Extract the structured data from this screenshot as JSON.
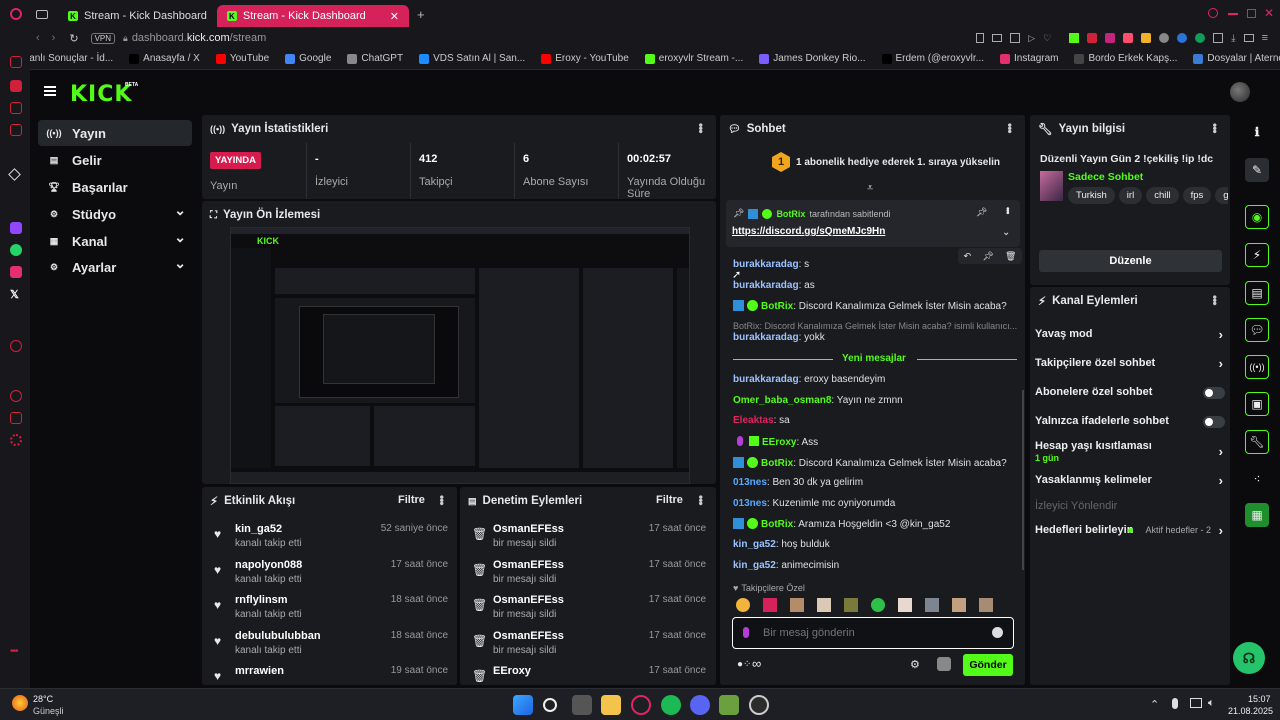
{
  "browser": {
    "tabs": [
      {
        "label": "Stream - Kick Dashboard",
        "active": false
      },
      {
        "label": "Stream - Kick Dashboard",
        "active": true
      }
    ],
    "vpn": "VPN",
    "url_host": "dashboard.",
    "url_domain": "kick.com",
    "url_path": "/stream",
    "bookmarks": [
      {
        "label": "Canlı Sonuçlar - İd...",
        "color": "#1e6fd9"
      },
      {
        "label": "Anasayfa / X",
        "color": "#000000"
      },
      {
        "label": "YouTube",
        "color": "#ff0000"
      },
      {
        "label": "Google",
        "color": "#4285f4"
      },
      {
        "label": "ChatGPT",
        "color": "#888888"
      },
      {
        "label": "VDS Satın Al | San...",
        "color": "#1a8cff"
      },
      {
        "label": "Eroxy - YouTube",
        "color": "#ff0000"
      },
      {
        "label": "eroxyvlr Stream -...",
        "color": "#53fc18"
      },
      {
        "label": "James Donkey Rio...",
        "color": "#7a5cff"
      },
      {
        "label": "Erdem (@eroxyvlr...",
        "color": "#000000"
      },
      {
        "label": "Instagram",
        "color": "#e1306c"
      },
      {
        "label": "Bordo Erkek Kapş...",
        "color": "#444444"
      },
      {
        "label": "Dosyalar | Aternos...",
        "color": "#3a7bd5"
      }
    ]
  },
  "kick": {
    "logo": "KICK",
    "beta": "BETA"
  },
  "sidebar": {
    "items": [
      {
        "label": "Yayın",
        "icon": "broadcast-icon",
        "active": true,
        "chev": false
      },
      {
        "label": "Gelir",
        "icon": "revenue-icon",
        "active": false,
        "chev": false
      },
      {
        "label": "Başarılar",
        "icon": "trophy-icon",
        "active": false,
        "chev": false
      },
      {
        "label": "Stüdyo",
        "icon": "studio-icon",
        "active": false,
        "chev": true
      },
      {
        "label": "Kanal",
        "icon": "channel-icon",
        "active": false,
        "chev": true
      },
      {
        "label": "Ayarlar",
        "icon": "settings-icon",
        "active": false,
        "chev": true
      }
    ]
  },
  "stats": {
    "title": "Yayın İstatistikleri",
    "live_badge": "YAYINDA",
    "items": [
      {
        "value": "",
        "label": "Yayın"
      },
      {
        "value": "-",
        "label": "İzleyici"
      },
      {
        "value": "412",
        "label": "Takipçi"
      },
      {
        "value": "6",
        "label": "Abone Sayısı"
      },
      {
        "value": "00:02:57",
        "label": "Yayında Olduğu Süre"
      }
    ]
  },
  "preview": {
    "title": "Yayın Ön İzlemesi"
  },
  "activity": {
    "title": "Etkinlik Akışı",
    "filter": "Filtre",
    "items": [
      {
        "name": "kin_ga52",
        "sub": "kanalı takip etti",
        "time": "52 saniye önce"
      },
      {
        "name": "napolyon088",
        "sub": "kanalı takip etti",
        "time": "17 saat önce"
      },
      {
        "name": "rnflylinsm",
        "sub": "kanalı takip etti",
        "time": "18 saat önce"
      },
      {
        "name": "debulubulubban",
        "sub": "kanalı takip etti",
        "time": "18 saat önce"
      },
      {
        "name": "mrrawien",
        "sub": "",
        "time": "19 saat önce"
      }
    ]
  },
  "moderation": {
    "title": "Denetim Eylemleri",
    "filter": "Filtre",
    "items": [
      {
        "name": "OsmanEFEss",
        "sub": "bir mesajı sildi",
        "time": "17 saat önce"
      },
      {
        "name": "OsmanEFEss",
        "sub": "bir mesajı sildi",
        "time": "17 saat önce"
      },
      {
        "name": "OsmanEFEss",
        "sub": "bir mesajı sildi",
        "time": "17 saat önce"
      },
      {
        "name": "OsmanEFEss",
        "sub": "bir mesajı sildi",
        "time": "17 saat önce"
      },
      {
        "name": "EEroxy",
        "sub": "",
        "time": "17 saat önce"
      }
    ]
  },
  "chat": {
    "title": "Sohbet",
    "gift_banner_number": "1",
    "gift_banner": "1 abonelik hediye ederek 1. sıraya yükselin",
    "pinned_by_user": "BotRix",
    "pinned_by_text": "tarafından sabitlendi",
    "pinned_link": "https://discord.gg/sQmeMJc9Hn",
    "messages": [
      {
        "user": "burakkaradag",
        "color": "#9cc3ff",
        "text": ": s"
      },
      {
        "user": "burakkaradag",
        "color": "#9cc3ff",
        "text": ": as"
      },
      {
        "user": "BotRix",
        "color": "#53fc18",
        "text": ": Discord Kanalımıza Gelmek İster Misin acaba?",
        "bot": true
      },
      {
        "reply": "BotRix: Discord Kanalımıza Gelmek İster Misin acaba? isimli kullanıcı..."
      },
      {
        "user": "burakkaradag",
        "color": "#9cc3ff",
        "text": ": yokk"
      }
    ],
    "new_messages": "Yeni mesajlar",
    "messages2": [
      {
        "user": "burakkaradag",
        "color": "#9cc3ff",
        "text": ": eroxy basendeyim"
      },
      {
        "user": "Omer_baba_osman8",
        "color": "#53fc18",
        "text": ": Yayın ne zmnn"
      },
      {
        "user": "Eleaktas",
        "color": "#e0245e",
        "text": ": sa"
      },
      {
        "user": "EEroxy",
        "color": "#53fc18",
        "text": ": Ass",
        "badges": true
      },
      {
        "user": "BotRix",
        "color": "#53fc18",
        "text": ": Discord Kanalımıza Gelmek İster Misin acaba?",
        "bot": true
      },
      {
        "user": "013nes",
        "color": "#5aa9ff",
        "text": ": Ben 30 dk ya gelirim"
      },
      {
        "user": "013nes",
        "color": "#5aa9ff",
        "text": ": Kuzenimle mc oyniyorumda"
      },
      {
        "user": "BotRix",
        "color": "#53fc18",
        "text": ": Aramıza Hoşgeldin <3 @kin_ga52",
        "bot": true
      },
      {
        "user": "kin_ga52",
        "color": "#9cc3ff",
        "text": ": hoş bulduk"
      },
      {
        "user": "kin_ga52",
        "color": "#9cc3ff",
        "text": ": animecimisin"
      }
    ],
    "followers_only_label": "Takipçilere Özel",
    "input_placeholder": "Bir mesaj gönderin",
    "send_label": "Gönder"
  },
  "streaminfo": {
    "title": "Yayın bilgisi",
    "stream_title": "Düzenli Yayın Gün 2 !çekiliş !ip !dc",
    "category": "Sadece Sohbet",
    "tags": [
      "Turkish",
      "irl",
      "chill",
      "fps",
      "gamin"
    ],
    "edit": "Düzenle"
  },
  "channel_actions": {
    "title": "Kanal Eylemleri",
    "items": [
      {
        "label": "Yavaş mod",
        "type": "chevron"
      },
      {
        "label": "Takipçilere özel sohbet",
        "type": "chevron"
      },
      {
        "label": "Abonelere özel sohbet",
        "type": "toggle"
      },
      {
        "label": "Yalnızca ifadelerle sohbet",
        "type": "toggle"
      },
      {
        "label": "Hesap yaşı kısıtlaması",
        "type": "chevron",
        "sub": "1 gün"
      },
      {
        "label": "Yasaklanmış kelimeler",
        "type": "chevron"
      },
      {
        "label": "İzleyici Yönlendir",
        "type": "disabled"
      },
      {
        "label": "Hedefleri belirleyin",
        "type": "chevron",
        "aside": "Aktif hedefler - 2"
      }
    ]
  },
  "taskbar": {
    "temp": "28°C",
    "weather": "Güneşli",
    "time": "15:07",
    "date": "21.08.2025"
  }
}
